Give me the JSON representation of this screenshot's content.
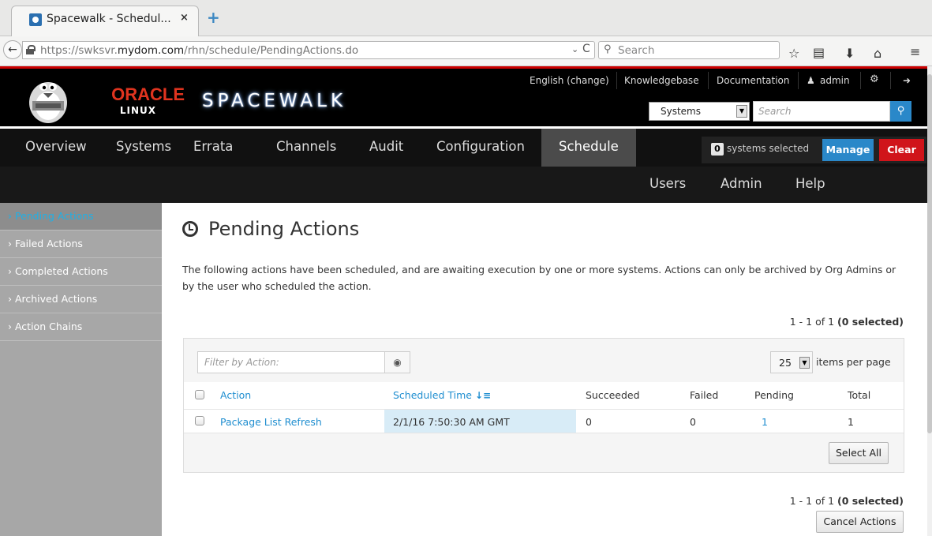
{
  "browser": {
    "tab_title": "Spacewalk - Schedul...",
    "tab_close": "×",
    "new_tab": "+",
    "back": "←",
    "url_prefix": "https://swksvr.",
    "url_domain": "mydom.com",
    "url_path": "/rhn/schedule/PendingActions.do",
    "url_dropdown": "⌄",
    "reload": "C",
    "search_placeholder": "Search",
    "icons": [
      "bookmark-star-icon",
      "reading-list-icon",
      "download-icon",
      "home-icon",
      "menu-icon"
    ]
  },
  "header": {
    "oracle": "ORACLE",
    "linux": "LINUX",
    "product": "SPACEWALK",
    "utility_links": [
      "English (change)",
      "Knowledgebase",
      "Documentation",
      "admin"
    ],
    "search_scope": "Systems",
    "search_placeholder": "Search",
    "accent_color": "#cc0000",
    "brand_blue": "#2a88c9"
  },
  "mainnav": {
    "items": [
      "Overview",
      "Systems",
      "Errata",
      "Channels",
      "Audit",
      "Configuration",
      "Schedule"
    ],
    "active": "Schedule",
    "second_row": [
      "Users",
      "Admin",
      "Help"
    ],
    "ssm": {
      "count": "0",
      "label": "systems selected",
      "manage": "Manage",
      "clear": "Clear"
    }
  },
  "sidebar": {
    "items": [
      {
        "label": "› Pending Actions",
        "active": true
      },
      {
        "label": "› Failed Actions",
        "active": false
      },
      {
        "label": "› Completed Actions",
        "active": false
      },
      {
        "label": "› Archived Actions",
        "active": false
      },
      {
        "label": "› Action Chains",
        "active": false
      }
    ]
  },
  "main": {
    "title": "Pending Actions",
    "description": "The following actions have been scheduled, and are awaiting execution by one or more systems. Actions can only be archived by Org Admins or by the user who scheduled the action.",
    "pager_text": "1 - 1 of 1 ",
    "pager_selected": "(0 selected)",
    "filter_placeholder": "Filter by Action:",
    "per_page": "25",
    "per_page_label": "items per page",
    "columns": [
      "Action",
      "Scheduled Time",
      "Succeeded",
      "Failed",
      "Pending",
      "Total"
    ],
    "rows": [
      {
        "action": "Package List Refresh",
        "scheduled": "2/1/16 7:50:30 AM GMT",
        "succeeded": "0",
        "failed": "0",
        "pending": "1",
        "total": "1"
      }
    ],
    "select_all": "Select All",
    "cancel_actions": "Cancel Actions"
  }
}
